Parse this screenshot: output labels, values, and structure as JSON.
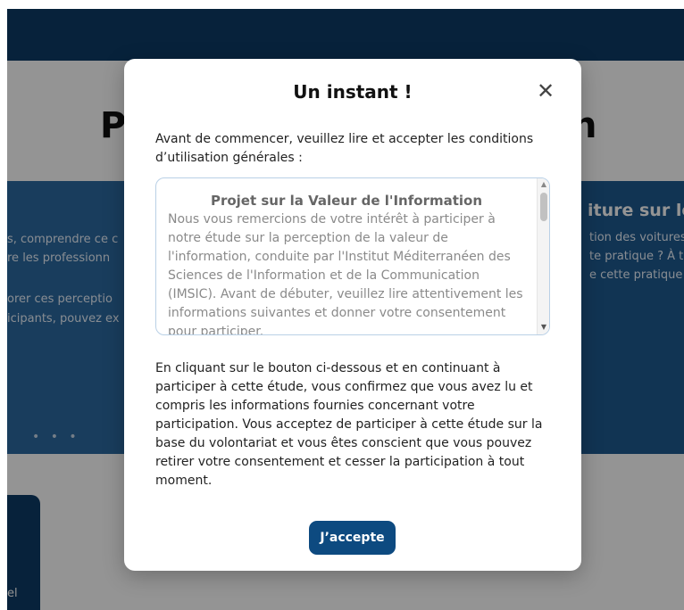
{
  "background": {
    "heading_left": "P",
    "heading_right": "n",
    "card_left_lines": [
      "s, comprendre ce c",
      "re  les  professionn",
      "orer ces perceptio",
      "icipants, pouvez ex"
    ],
    "card_dots": "• • •",
    "card_right_heading": "iture sur le",
    "card_right_lines": [
      "tion des voitures",
      "te pratique ? À t",
      "e cette pratique d"
    ],
    "bottom_card_text": "el"
  },
  "modal": {
    "title": "Un instant !",
    "close_symbol": "✕",
    "intro": "Avant de commencer, veuillez lire et accepter les conditions d’utilisation générales :",
    "terms": {
      "title": "Projet sur la Valeur de l'Information",
      "body": "Nous vous remercions de votre intérêt à participer à notre étude sur la perception de la valeur de l'information, conduite par l'Institut Méditerranéen des Sciences de l'Information et de la Communication (IMSIC). Avant de débuter, veuillez lire attentivement les informations suivantes et donner votre consentement pour participer."
    },
    "consent_text": "En cliquant sur le bouton ci-dessous et en continuant à participer à cette étude, vous confirmez que vous avez lu et compris les informations fournies concernant votre participation. Vous acceptez de participer à cette étude sur la base du volontariat et vous êtes conscient que vous pouvez retirer votre consentement et cesser la participation à tout moment.",
    "accept_label": "J’accepte"
  },
  "colors": {
    "navy": "#0d3b66",
    "button": "#0d4a80",
    "card_blue": "#2b6aa0"
  }
}
